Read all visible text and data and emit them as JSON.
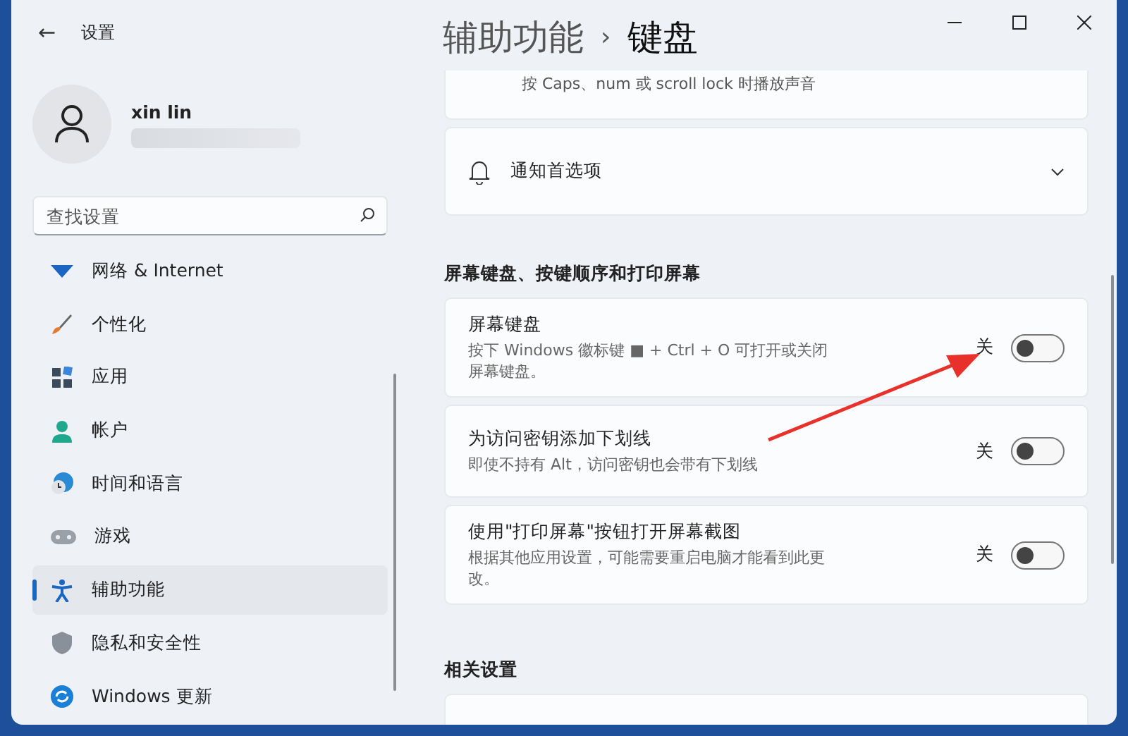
{
  "window": {
    "title": "设置",
    "back": "←"
  },
  "profile": {
    "name": "xin lin"
  },
  "search": {
    "placeholder": "查找设置"
  },
  "sidebar": {
    "items": [
      {
        "label": "网络 & Internet",
        "kind": "network",
        "selected": false
      },
      {
        "label": "个性化",
        "kind": "brush",
        "selected": false
      },
      {
        "label": "应用",
        "kind": "apps",
        "selected": false
      },
      {
        "label": "帐户",
        "kind": "person",
        "selected": false
      },
      {
        "label": "时间和语言",
        "kind": "globe",
        "selected": false
      },
      {
        "label": "游戏",
        "kind": "gamepad",
        "selected": false
      },
      {
        "label": "辅助功能",
        "kind": "accessibility",
        "selected": true
      },
      {
        "label": "隐私和安全性",
        "kind": "shield",
        "selected": false
      },
      {
        "label": "Windows 更新",
        "kind": "update",
        "selected": false
      }
    ]
  },
  "breadcrumb": {
    "parent": "辅助功能",
    "separator": "›",
    "current": "键盘"
  },
  "top_card": {
    "description": "按 Caps、num 或 scroll lock 时播放声音"
  },
  "notification_card": {
    "label": "通知首选项",
    "expanded": false
  },
  "section": {
    "title": "屏幕键盘、按键顺序和打印屏幕",
    "settings": [
      {
        "title": "屏幕键盘",
        "description": "按下 Windows 徽标键 ■ + Ctrl + O 可打开或关闭屏幕键盘。",
        "state_label": "关",
        "on": false
      },
      {
        "title": "为访问密钥添加下划线",
        "description": "即使不持有 Alt，访问密钥也会带有下划线",
        "state_label": "关",
        "on": false
      },
      {
        "title": "使用\"打印屏幕\"按钮打开屏幕截图",
        "description": "根据其他应用设置，可能需要重启电脑才能看到此更改。",
        "state_label": "关",
        "on": false
      }
    ]
  },
  "related": {
    "title": "相关设置"
  }
}
